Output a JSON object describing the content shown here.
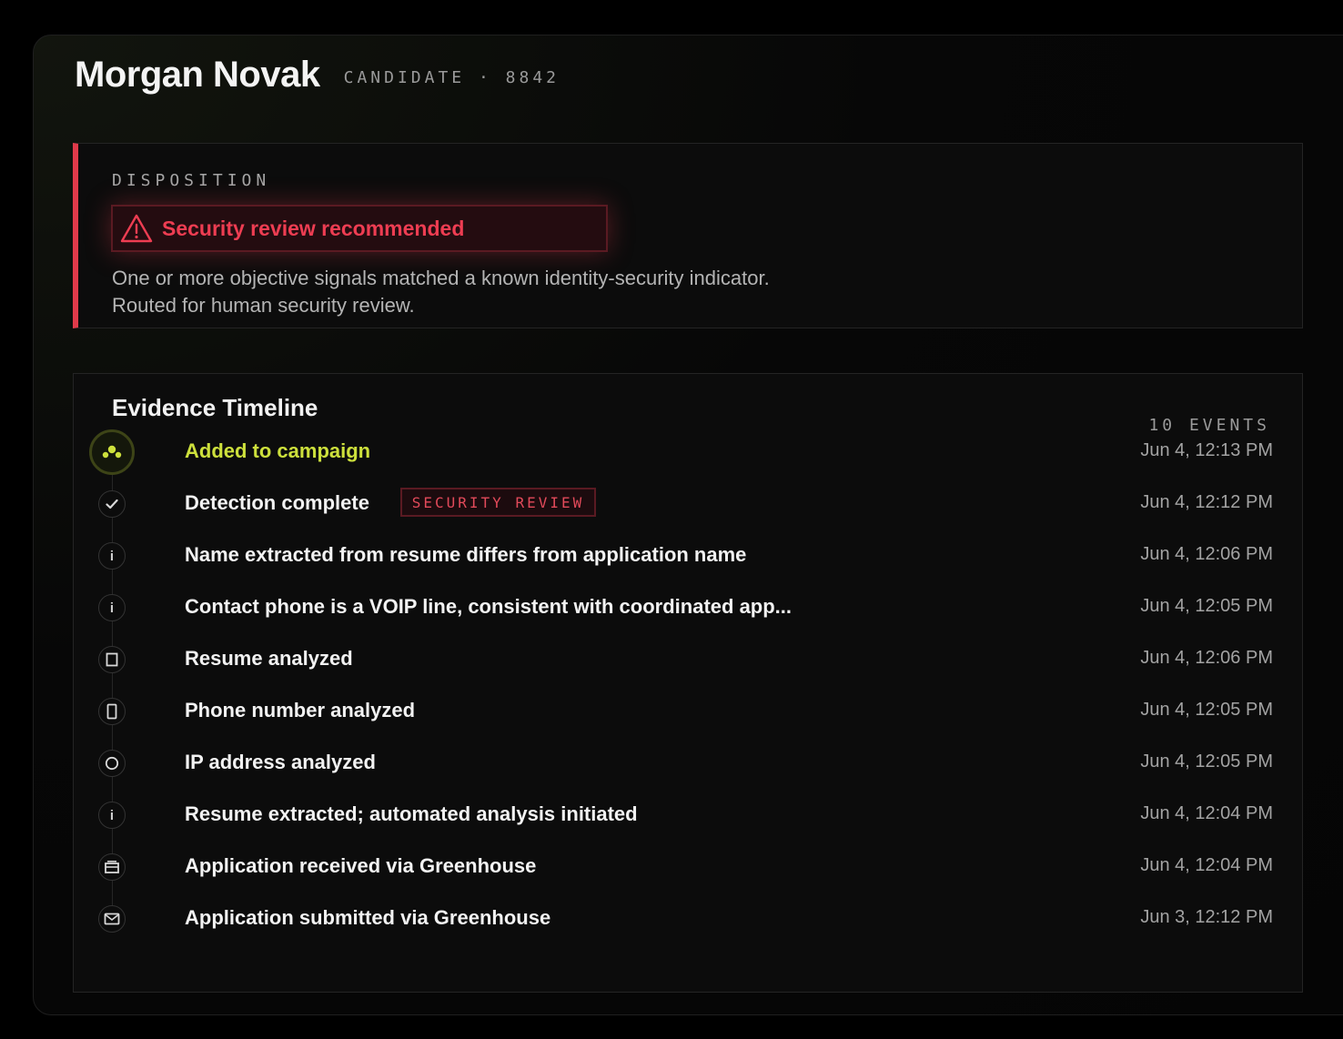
{
  "candidate": {
    "name": "Morgan Novak",
    "meta": "CANDIDATE · 8842"
  },
  "disposition": {
    "label": "DISPOSITION",
    "status": "Security review recommended",
    "status_icon": "warning-triangle-icon",
    "description_line1": "One or more objective signals matched a known identity-security indicator.",
    "description_line2": "Routed for human security review.",
    "accent_color": "#e03a4a"
  },
  "timeline": {
    "title": "Evidence Timeline",
    "count": "10 EVENTS",
    "events": [
      {
        "title": "Added to campaign",
        "time": "Jun 4, 12:13 PM",
        "icon": "campaign-icon",
        "highlight": true
      },
      {
        "title": "Detection complete",
        "time": "Jun 4, 12:12 PM",
        "icon": "check-icon",
        "badge": "SECURITY REVIEW"
      },
      {
        "title": "Name extracted from resume differs from application name",
        "time": "Jun 4, 12:06 PM",
        "icon": "info-icon"
      },
      {
        "title": "Contact phone is a VOIP line, consistent with coordinated app...",
        "time": "Jun 4, 12:05 PM",
        "icon": "info-icon"
      },
      {
        "title": "Resume analyzed",
        "time": "Jun 4, 12:06 PM",
        "icon": "document-icon"
      },
      {
        "title": "Phone number analyzed",
        "time": "Jun 4, 12:05 PM",
        "icon": "phone-icon"
      },
      {
        "title": "IP address analyzed",
        "time": "Jun 4, 12:05 PM",
        "icon": "globe-icon"
      },
      {
        "title": "Resume extracted; automated analysis initiated",
        "time": "Jun 4, 12:04 PM",
        "icon": "info-icon"
      },
      {
        "title": "Application received via Greenhouse",
        "time": "Jun 4, 12:04 PM",
        "icon": "inbox-icon"
      },
      {
        "title": "Application submitted via Greenhouse",
        "time": "Jun 3, 12:12 PM",
        "icon": "mail-icon"
      }
    ]
  },
  "colors": {
    "highlight": "#cde03c",
    "alert": "#ee3d52"
  }
}
